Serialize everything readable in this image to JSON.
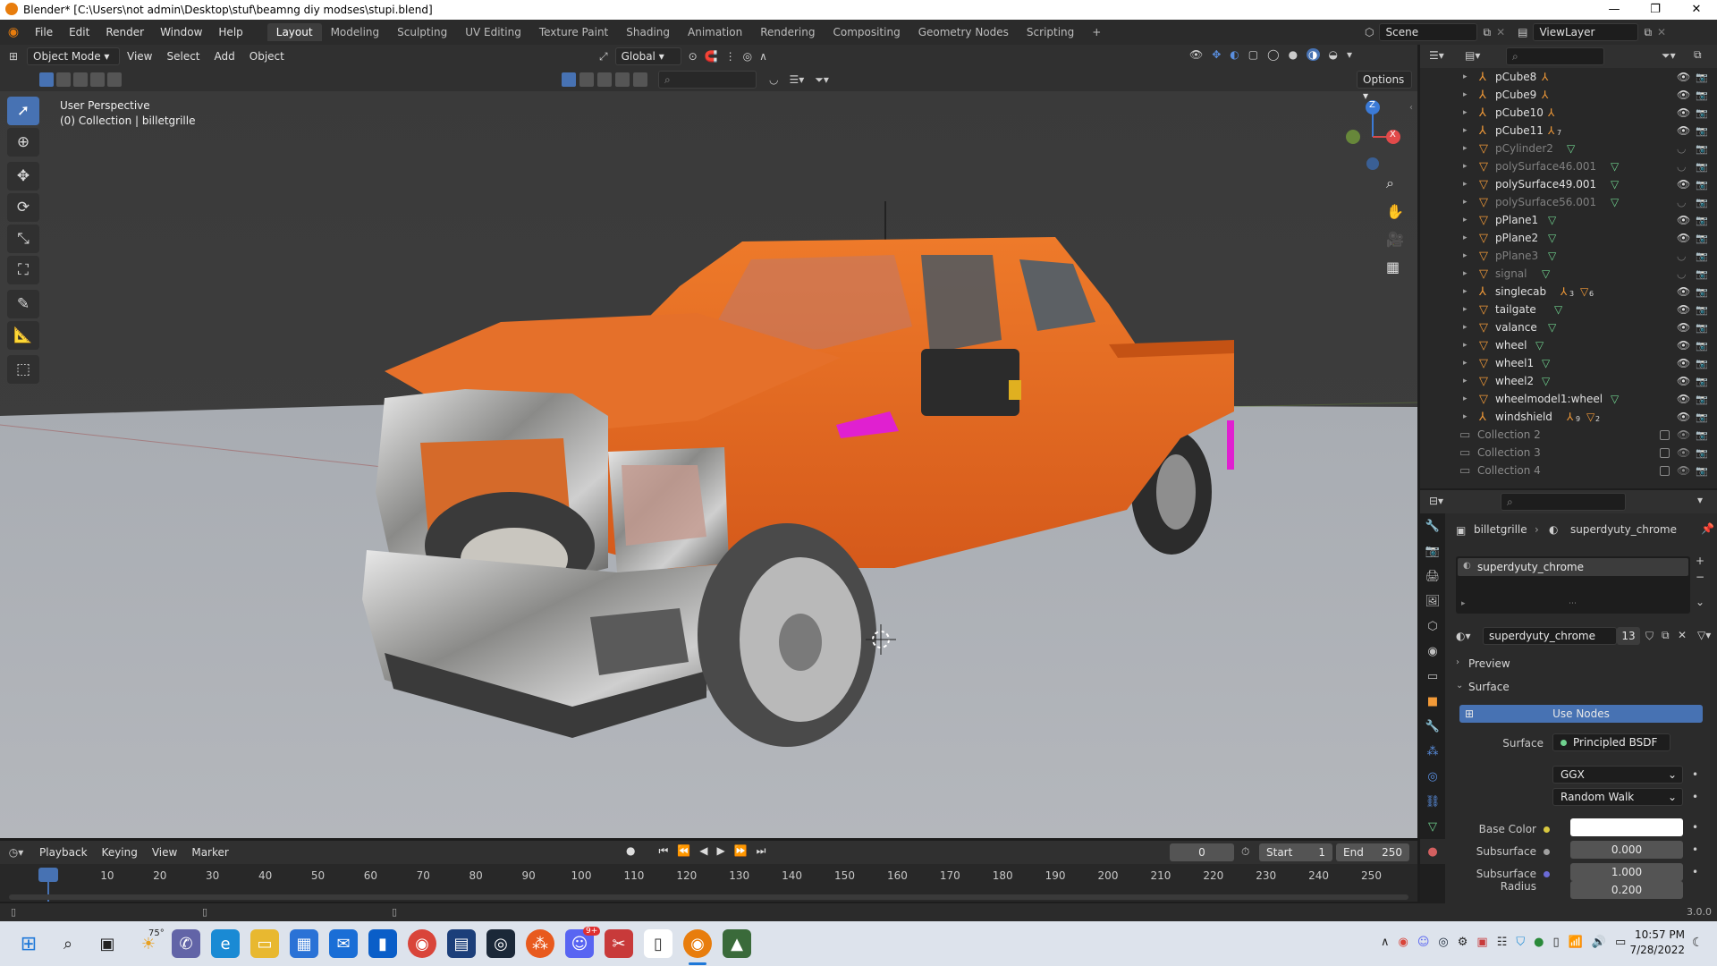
{
  "window": {
    "title": "Blender* [C:\\Users\\not admin\\Desktop\\stuf\\beamng diy modses\\stupi.blend]",
    "minimize": "—",
    "maximize": "❐",
    "close": "✕"
  },
  "menubar": {
    "menus": [
      "File",
      "Edit",
      "Render",
      "Window",
      "Help"
    ],
    "workspaces": [
      "Layout",
      "Modeling",
      "Sculpting",
      "UV Editing",
      "Texture Paint",
      "Shading",
      "Animation",
      "Rendering",
      "Compositing",
      "Geometry Nodes",
      "Scripting"
    ],
    "active_workspace": "Layout",
    "add_workspace": "+",
    "scene": "Scene",
    "view_layer": "ViewLayer"
  },
  "viewport": {
    "mode": "Object Mode",
    "menus": [
      "View",
      "Select",
      "Add",
      "Object"
    ],
    "transform_orientation": "Global",
    "options_label": "Options",
    "info_line1": "User Perspective",
    "info_line2": "(0) Collection | billetgrille",
    "gizmo": {
      "z": "Z",
      "x": "X"
    }
  },
  "outliner": {
    "objects": [
      {
        "name": "pCube8",
        "dim": false,
        "icon": "armature"
      },
      {
        "name": "pCube9",
        "dim": false,
        "icon": "armature"
      },
      {
        "name": "pCube10",
        "dim": false,
        "icon": "armature"
      },
      {
        "name": "pCube11",
        "dim": false,
        "icon": "armature",
        "badge": "7"
      },
      {
        "name": "pCylinder2",
        "dim": true,
        "icon": "mesh"
      },
      {
        "name": "polySurface46.001",
        "dim": true,
        "icon": "mesh"
      },
      {
        "name": "polySurface49.001",
        "dim": false,
        "icon": "mesh"
      },
      {
        "name": "polySurface56.001",
        "dim": true,
        "icon": "mesh"
      },
      {
        "name": "pPlane1",
        "dim": false,
        "icon": "mesh"
      },
      {
        "name": "pPlane2",
        "dim": false,
        "icon": "mesh"
      },
      {
        "name": "pPlane3",
        "dim": true,
        "icon": "mesh"
      },
      {
        "name": "signal",
        "dim": true,
        "icon": "mesh"
      },
      {
        "name": "singlecab",
        "dim": false,
        "icon": "armature",
        "badge": "3",
        "badge2": "6"
      },
      {
        "name": "tailgate",
        "dim": false,
        "icon": "mesh"
      },
      {
        "name": "valance",
        "dim": false,
        "icon": "mesh"
      },
      {
        "name": "wheel",
        "dim": false,
        "icon": "mesh"
      },
      {
        "name": "wheel1",
        "dim": false,
        "icon": "mesh"
      },
      {
        "name": "wheel2",
        "dim": false,
        "icon": "mesh"
      },
      {
        "name": "wheelmodel1:wheel",
        "dim": false,
        "icon": "mesh"
      },
      {
        "name": "windshield",
        "dim": false,
        "icon": "armature",
        "badge": "9",
        "badge2": "2"
      }
    ],
    "collections": [
      "Collection 2",
      "Collection 3",
      "Collection 4"
    ]
  },
  "properties": {
    "breadcrumb_object": "billetgrille",
    "breadcrumb_material": "superdyuty_chrome",
    "slot_name": "superdyuty_chrome",
    "material_name": "superdyuty_chrome",
    "user_count": "13",
    "preview_label": "Preview",
    "surface_label": "Surface",
    "use_nodes": "Use Nodes",
    "surface_field_label": "Surface",
    "surface_shader": "Principled BSDF",
    "distribution": "GGX",
    "subsurface_method": "Random Walk",
    "base_color_label": "Base Color",
    "subsurface_label": "Subsurface",
    "subsurface_value": "0.000",
    "subsurface_radius_label": "Subsurface Radius",
    "radius_values": [
      "1.000",
      "0.200"
    ]
  },
  "timeline": {
    "menus": [
      "Playback",
      "Keying",
      "View",
      "Marker"
    ],
    "current_frame": "0",
    "start_label": "Start",
    "start_value": "1",
    "end_label": "End",
    "end_value": "250",
    "ticks": [
      "0",
      "10",
      "20",
      "30",
      "40",
      "50",
      "60",
      "70",
      "80",
      "90",
      "100",
      "110",
      "120",
      "130",
      "140",
      "150",
      "160",
      "170",
      "180",
      "190",
      "200",
      "210",
      "220",
      "230",
      "240",
      "250"
    ]
  },
  "statusbar": {
    "version": "3.0.0"
  },
  "taskbar": {
    "weather": "75°",
    "discord_badge": "9+",
    "time": "10:57 PM",
    "date": "7/28/2022"
  },
  "colors": {
    "accent": "#4772b3",
    "truck_orange": "#e0661f",
    "object_icon": "#f29a38",
    "mesh_icon": "#6fd18e"
  }
}
